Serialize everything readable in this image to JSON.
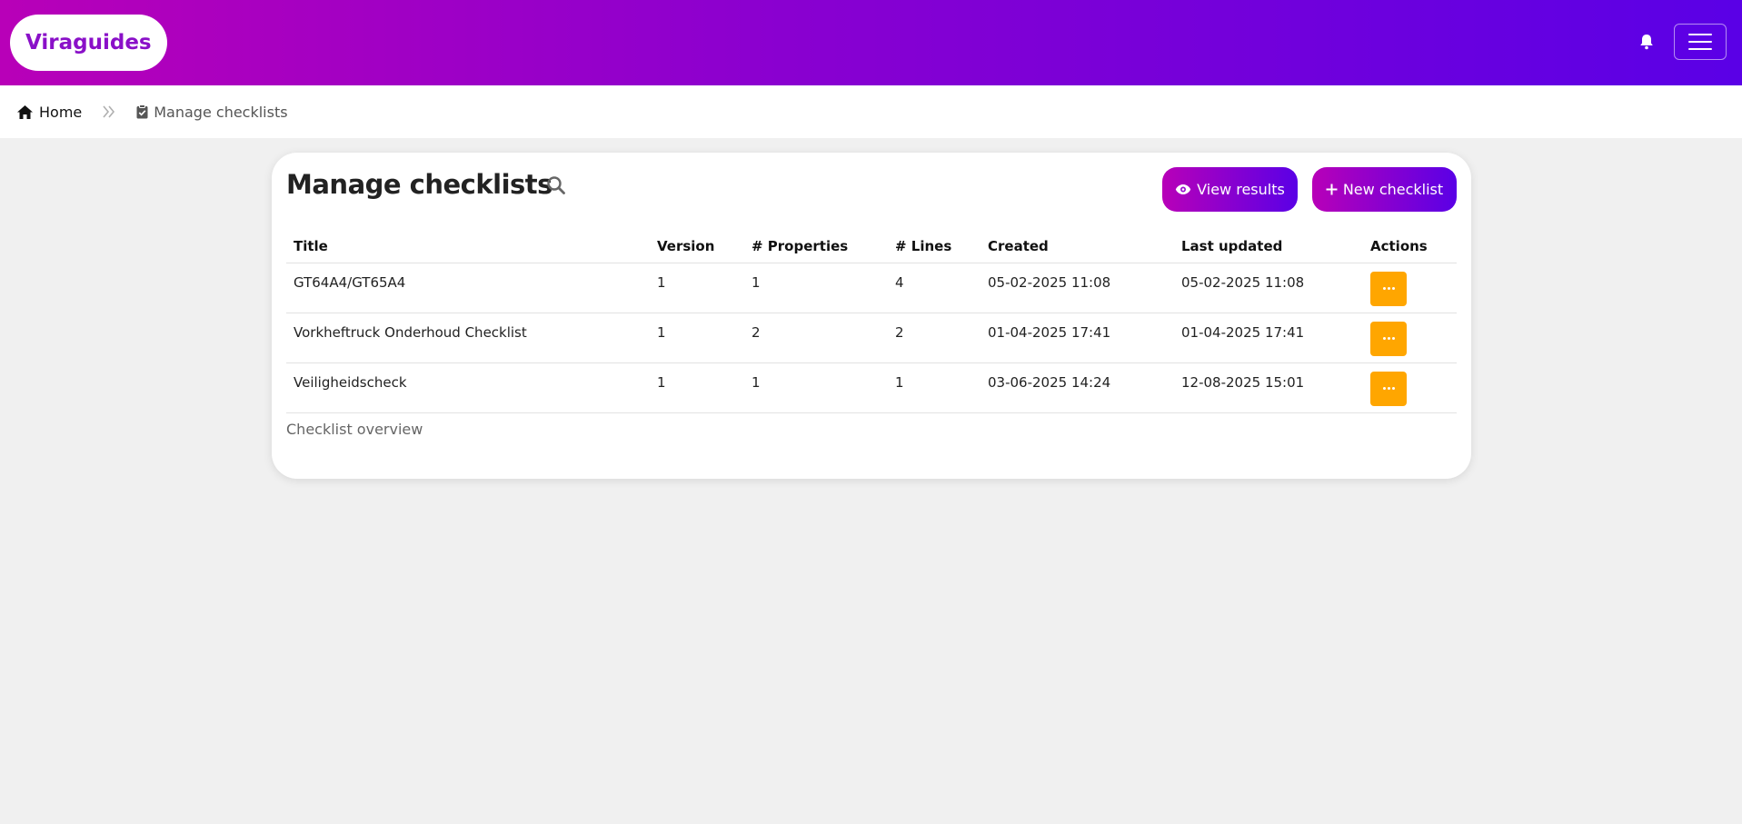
{
  "brand": "Viraguides",
  "header": {
    "bell_icon": "bell-icon",
    "menu_icon": "hamburger-icon"
  },
  "breadcrumb": {
    "home": "Home",
    "current": "Manage checklists"
  },
  "page": {
    "title": "Manage checklists",
    "view_results_label": "View results",
    "new_checklist_label": "New checklist",
    "caption": "Checklist overview"
  },
  "table": {
    "headers": [
      "Title",
      "Version",
      "# Properties",
      "# Lines",
      "Created",
      "Last updated",
      "Actions"
    ],
    "rows": [
      [
        "GT64A4/GT65A4",
        "1",
        "1",
        "4",
        "05-02-2025 11:08",
        "05-02-2025 11:08"
      ],
      [
        "Vorkheftruck Onderhoud Checklist",
        "1",
        "2",
        "2",
        "01-04-2025 17:41",
        "01-04-2025 17:41"
      ],
      [
        "Veiligheidscheck",
        "1",
        "1",
        "1",
        "03-06-2025 14:24",
        "12-08-2025 15:01"
      ]
    ]
  },
  "colors": {
    "accent_start": "#b800b8",
    "accent_end": "#5a00e6",
    "action_button": "#ffa600"
  }
}
